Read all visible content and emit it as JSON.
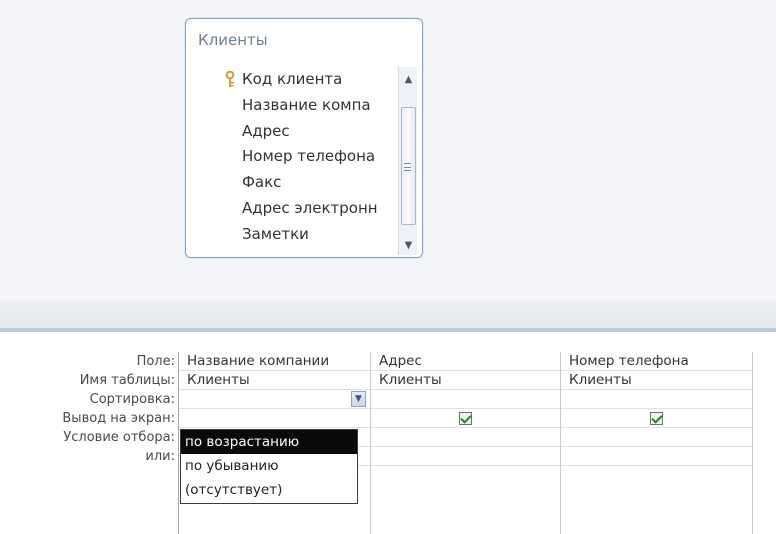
{
  "table": {
    "title": "Клиенты",
    "fields": [
      {
        "label": "Код клиента",
        "icon": "key-icon"
      },
      {
        "label": "Название компа",
        "icon": ""
      },
      {
        "label": "Адрес",
        "icon": ""
      },
      {
        "label": "Номер телефона",
        "icon": ""
      },
      {
        "label": "Факс",
        "icon": ""
      },
      {
        "label": "Адрес электронн",
        "icon": ""
      },
      {
        "label": "Заметки",
        "icon": ""
      }
    ]
  },
  "grid": {
    "row_labels": [
      "Поле:",
      "Имя таблицы:",
      "Сортировка:",
      "Вывод на экран:",
      "Условие отбора:",
      "или:"
    ],
    "columns": [
      {
        "field": "Название компании",
        "table": "Клиенты",
        "sort": "",
        "show": true
      },
      {
        "field": "Адрес",
        "table": "Клиенты",
        "sort": "",
        "show": true
      },
      {
        "field": "Номер телефона",
        "table": "Клиенты",
        "sort": "",
        "show": true
      }
    ]
  },
  "sort_dropdown": {
    "options": [
      "по возрастанию",
      "по убыванию",
      "(отсутствует)"
    ],
    "selected_index": 0
  }
}
